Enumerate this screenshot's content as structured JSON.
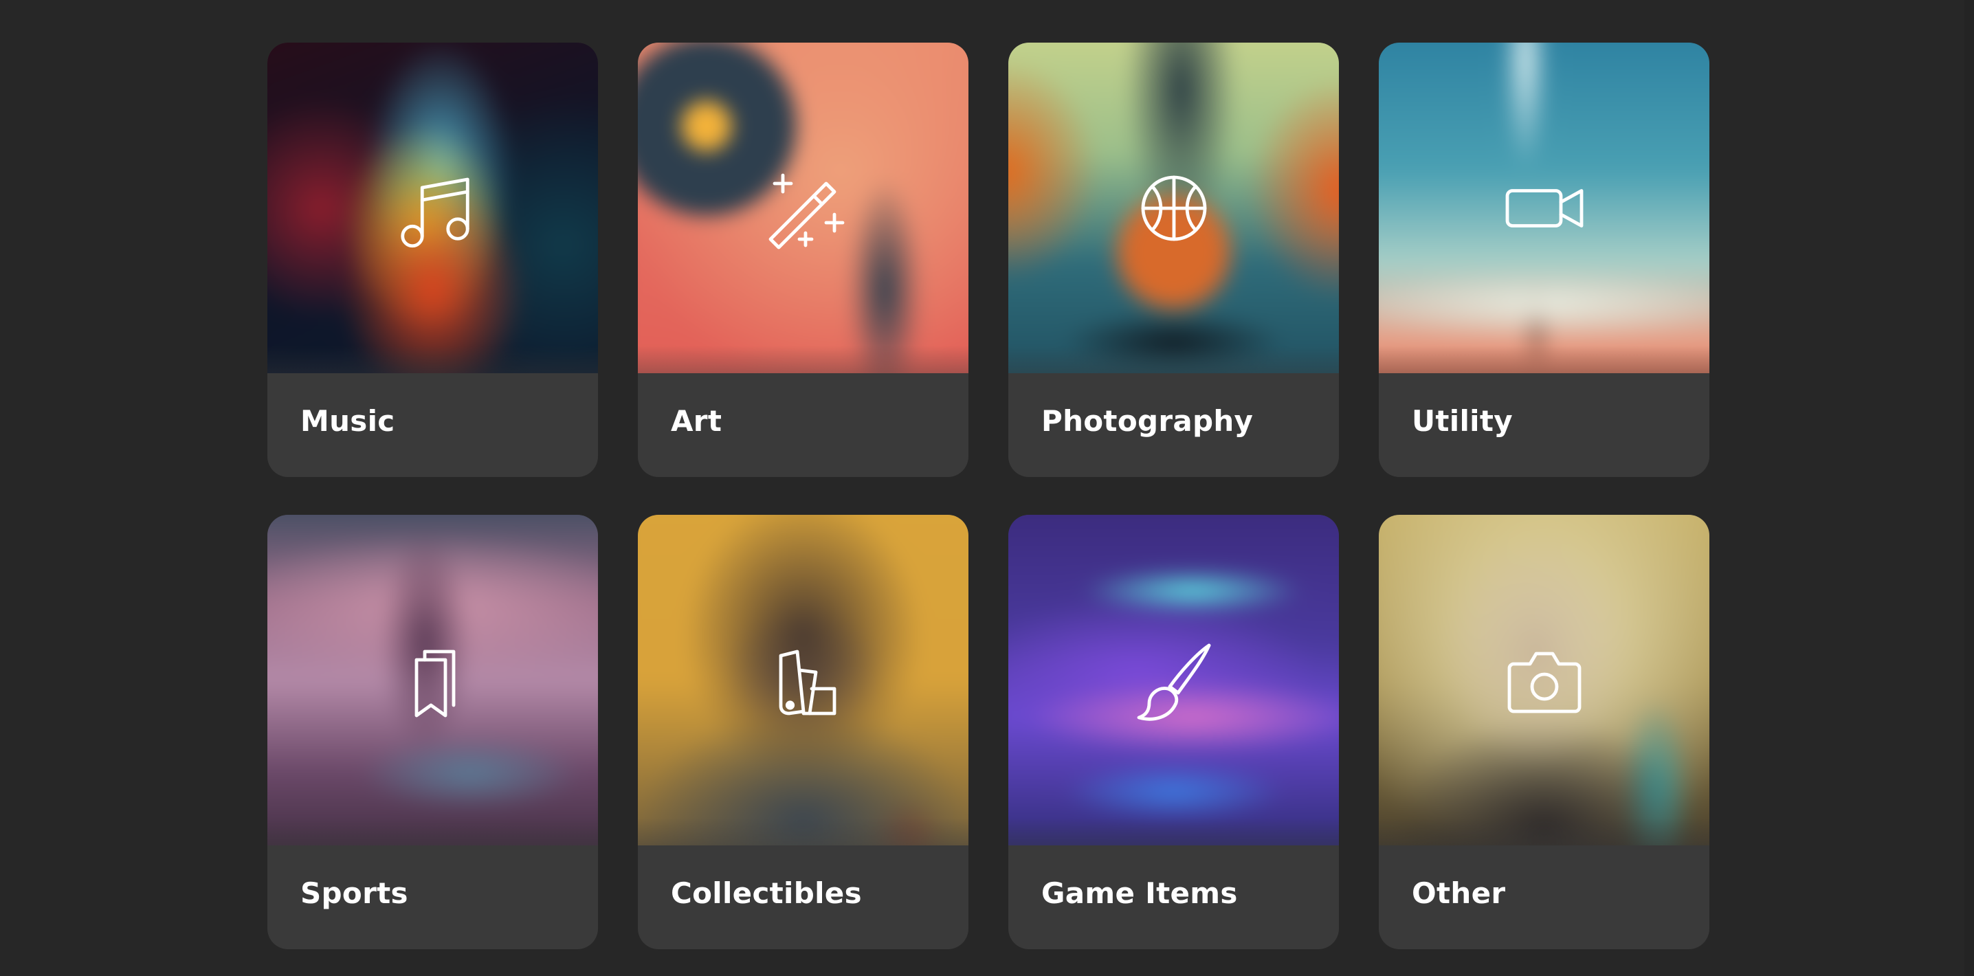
{
  "categories": [
    {
      "label": "Music",
      "icon": "music-note-icon"
    },
    {
      "label": "Art",
      "icon": "magic-wand-icon"
    },
    {
      "label": "Photography",
      "icon": "basketball-icon"
    },
    {
      "label": "Utility",
      "icon": "video-camera-icon"
    },
    {
      "label": "Sports",
      "icon": "bookmarks-icon"
    },
    {
      "label": "Collectibles",
      "icon": "swatches-icon"
    },
    {
      "label": "Game Items",
      "icon": "paintbrush-icon"
    },
    {
      "label": "Other",
      "icon": "camera-icon"
    }
  ],
  "colors": {
    "background": "#272727",
    "card": "#3a3a3a",
    "text": "#ffffff",
    "icon_stroke": "#ffffff"
  }
}
